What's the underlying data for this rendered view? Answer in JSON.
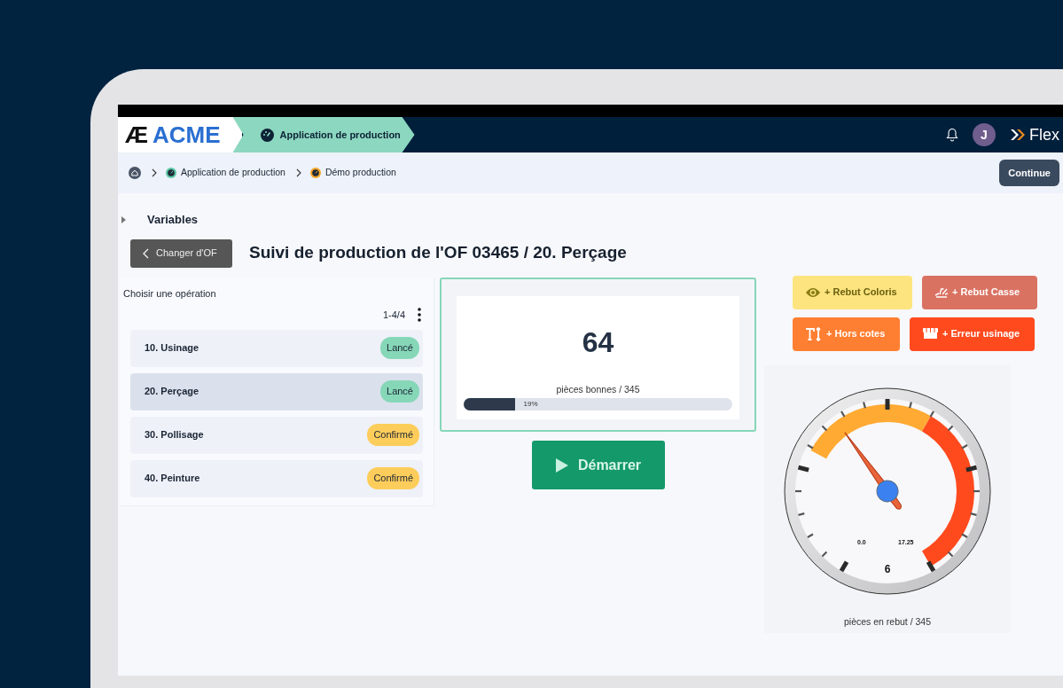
{
  "header": {
    "logo_mark": "Æ",
    "logo_text": "ACME",
    "app_tab": "Application de production",
    "avatar": "J",
    "brand": "Flex"
  },
  "breadcrumb": [
    {
      "label": "Application de production",
      "color": "#5cc9a7"
    },
    {
      "label": "Démo production",
      "color": "#f5a524"
    }
  ],
  "continue_button": "Continue",
  "variables": {
    "label": "Variables",
    "expanded": false
  },
  "back_button": "Changer d'OF",
  "title": "Suivi de production de l'OF 03465 / 20. Perçage",
  "operations": {
    "heading": "Choisir une opération",
    "range": "1-4/4",
    "items": [
      {
        "label": "10. Usinage",
        "status": "Lancé",
        "kind": "launched",
        "selected": false
      },
      {
        "label": "20. Perçage",
        "status": "Lancé",
        "kind": "launched",
        "selected": true
      },
      {
        "label": "30. Pollisage",
        "status": "Confirmé",
        "kind": "confirmed",
        "selected": false
      },
      {
        "label": "40. Peinture",
        "status": "Confirmé",
        "kind": "confirmed",
        "selected": false
      }
    ]
  },
  "counter": {
    "value": "64",
    "caption": "pièces bonnes / 345",
    "level": 0.19,
    "reading": "19%"
  },
  "start_button": "Démarrer",
  "scrap_buttons": [
    {
      "kind": "eye",
      "label": "+ Rebut Coloris",
      "color": "#fde47f"
    },
    {
      "kind": "splash",
      "label": "+ Rebut Casse",
      "color": "#da7262"
    },
    {
      "kind": "height",
      "label": "+ Hors cotes",
      "color": "#ff7f32"
    },
    {
      "kind": "bin",
      "label": "+ Erreur usinage",
      "color": "#ff4a1e"
    }
  ],
  "gauge": {
    "level": 0.38,
    "value": "6",
    "labels": [
      "0.0",
      "17.25"
    ],
    "caption": "pièces en rebut / 345"
  }
}
